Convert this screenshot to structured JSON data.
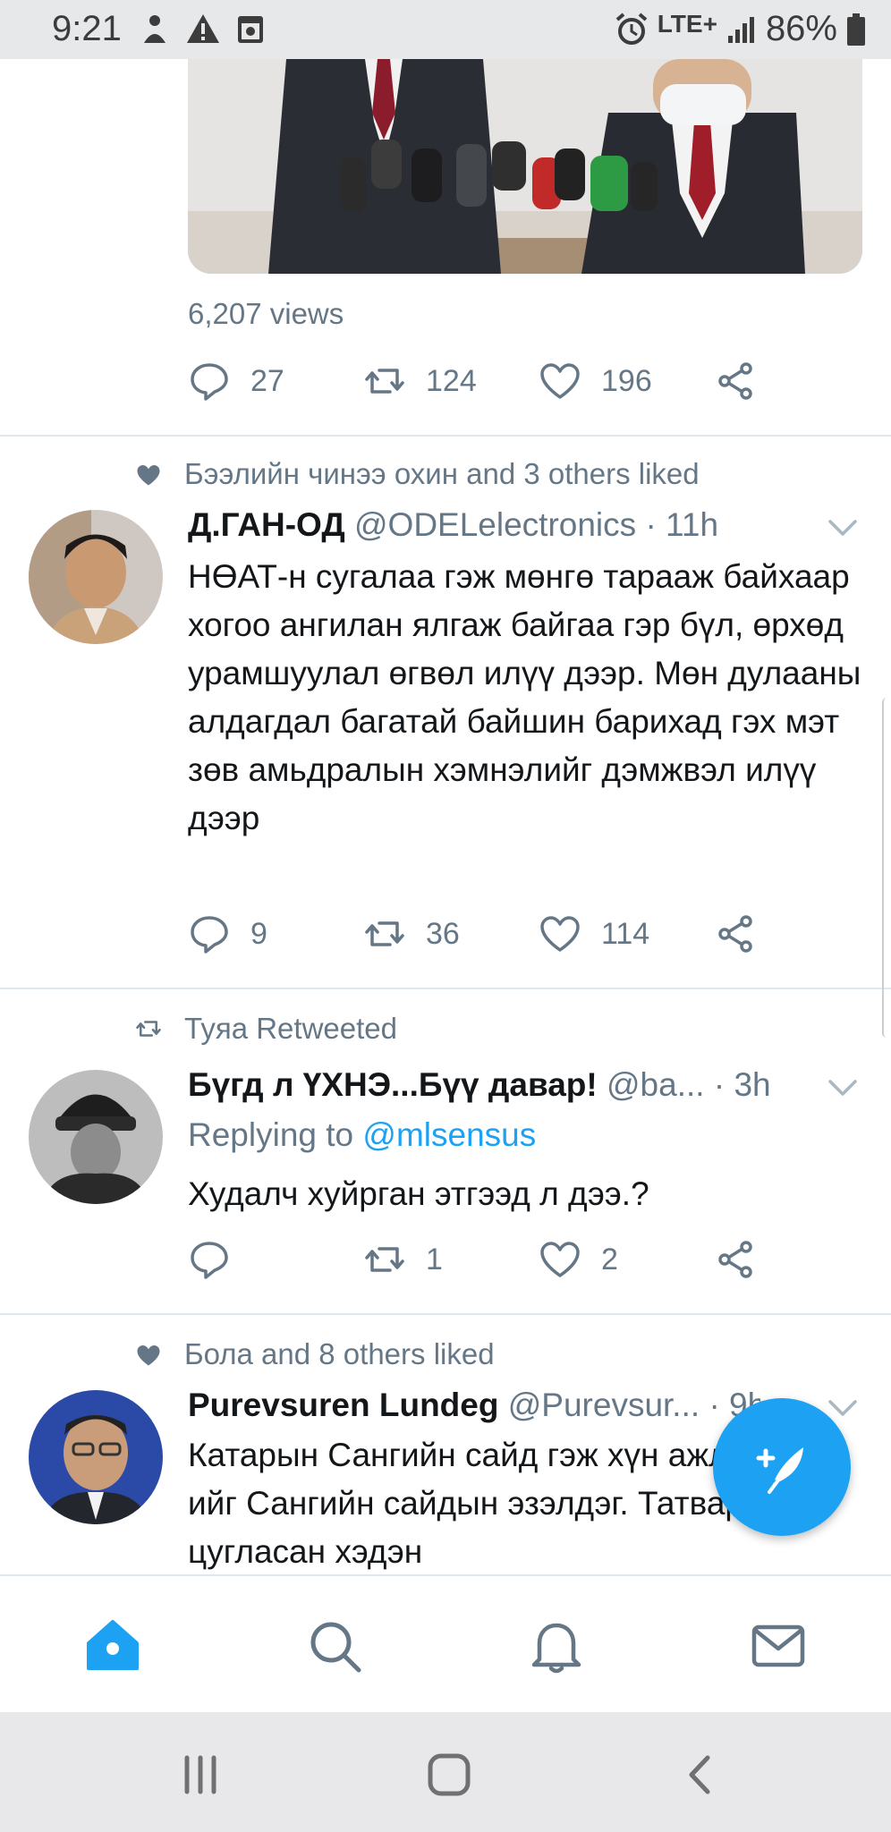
{
  "status_bar": {
    "time": "9:21",
    "network": "LTE+",
    "battery": "86%"
  },
  "tweet_prev": {
    "views": "6,207 views",
    "replies": "27",
    "retweets": "124",
    "likes": "196"
  },
  "tweet1": {
    "context": "Бээлийн чинээ охин and 3 others liked",
    "name": "Д.ГАН-ОД",
    "handle": "@ODELelectronics",
    "time": "· 11h",
    "text": "НӨАТ-н сугалаа гэж мөнгө тарааж байхаар хогоо ангилан ялгаж байгаа гэр бүл, өрхөд урамшуулал өгвөл илүү дээр. Мөн дулааны алдагдал багатай байшин барихад гэх мэт зөв амьдралын хэмнэлийг дэмжвэл илүү дээр",
    "replies": "9",
    "retweets": "36",
    "likes": "114"
  },
  "tweet2": {
    "context": "Tyяa Retweeted",
    "name": "Бүгд л ҮХНЭ...Бүү давар!",
    "handle": "@ba...",
    "time": "· 3h",
    "reply_prefix": "Replying to ",
    "reply_handle": "@mlsensus",
    "text": "Худалч хуйрган этгээд л дээ.?",
    "replies": "",
    "retweets": "1",
    "likes": "2"
  },
  "tweet3": {
    "context": "Бола and 8 others liked",
    "name": "Purevsuren Lundeg",
    "handle": "@Purevsur...",
    "time": "· 9h",
    "text": "Катарын Сангийн сайд гэж хүн ажлын 5%-ийг Сангийн сайдын эзэлдэг. Татвараар цугласан хэдэн"
  },
  "colors": {
    "accent": "#1da1f2",
    "muted": "#657786",
    "text": "#14171a"
  },
  "icons": {
    "nav": [
      "home-icon",
      "search-icon",
      "notifications-icon",
      "messages-icon"
    ],
    "compose": "compose-tweet-icon"
  }
}
